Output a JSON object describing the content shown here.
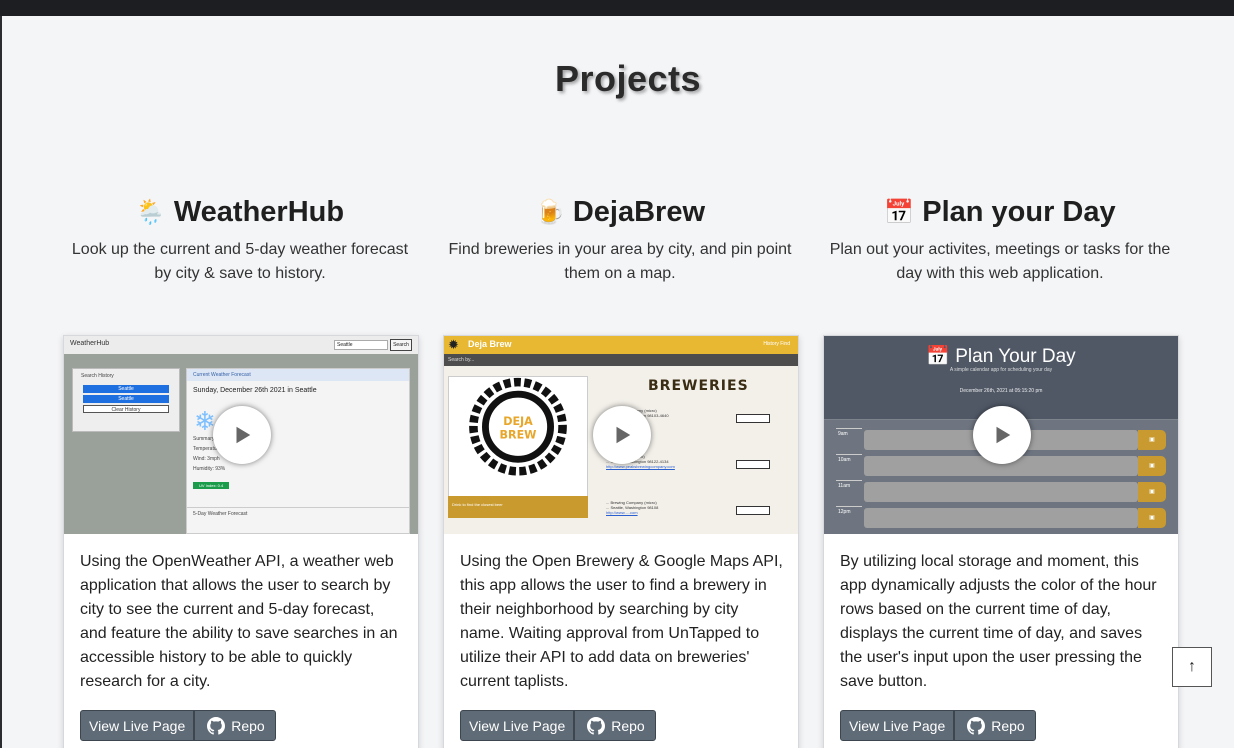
{
  "page": {
    "section_title": "Projects",
    "scroll_top_label": "↑"
  },
  "colors": {
    "background": "#f4f5f7",
    "topbar": "#1c1e21",
    "button": "#5f6b76",
    "card": "#ffffff"
  },
  "projects": [
    {
      "emoji": "🌦️",
      "title": "WeatherHub",
      "tagline": "Look up the current and 5-day weather forecast by city & save to history.",
      "description": "Using the OpenWeather API, a weather web application that allows the user to search by city to see the current and 5-day forecast, and feature the ability to save searches in an accessible history to be able to quickly research for a city.",
      "live_label": "View Live Page",
      "repo_label": "Repo",
      "thumb": {
        "app_name": "WeatherHub",
        "search_value": "Seattle",
        "search_button": "Search",
        "history_heading": "Search History",
        "history_items": [
          "Seattle",
          "Seattle"
        ],
        "clear_label": "Clear History",
        "tab_label": "Current Weather Forecast",
        "current_title": "Sunday, December 26th 2021 in Seattle",
        "lines": [
          "Summary: ...",
          "Temperature: ...",
          "Wind: 3mph",
          "Humidity: 93%"
        ],
        "uv_badge": "UV Index: 0.4",
        "forecast_label": "5-Day Weather Forecast"
      }
    },
    {
      "emoji": "🍺",
      "title": "DejaBrew",
      "tagline": "Find breweries in your area by city, and pin point them on a map.",
      "description": "Using the Open Brewery & Google Maps API, this app allows the user to find a brewery in their neighborhood by searching by city name. Waiting approval from UnTapped to utilize their API to add data on breweries' current taplists.",
      "live_label": "View Live Page",
      "repo_label": "Repo",
      "thumb": {
        "app_name": "Deja Brew",
        "nav": "History   Find",
        "sub": "Search by...",
        "heading": "BREWERIES",
        "logo_text": "DEJA BREW",
        "logo_caption": "Drink to find the closest beer",
        "rows": [
          {
            "name": "... Brewing Company (micro)",
            "addr": "... Seattle, Washington 98103-4640",
            "link": "http://www.....com"
          },
          {
            "name": "... Brewing Co (micro)",
            "addr": "... Seattle, Washington 98122-4134",
            "link": "http://www.peaksbrewingcompany.com"
          },
          {
            "name": "... Brewing Company (micro)",
            "addr": "... Seattle, Washington 98108",
            "link": "http://www.....com"
          }
        ]
      }
    },
    {
      "emoji": "📅",
      "title": "Plan your Day",
      "tagline": "Plan out your activites, meetings or tasks for the day with this web application.",
      "description": "By utilizing local storage and moment, this app dynamically adjusts the color of the hour rows based on the current time of day, displays the current time of day, and saves the user's input upon the user pressing the save button.",
      "live_label": "View Live Page",
      "repo_label": "Repo",
      "thumb": {
        "title": "📅 Plan Your Day",
        "subtitle": "A simple calendar app for scheduling your day",
        "date": "December 26th, 2021 at 05:15:20 pm",
        "hours": [
          "9am",
          "10am",
          "11am",
          "12pm"
        ]
      }
    }
  ]
}
